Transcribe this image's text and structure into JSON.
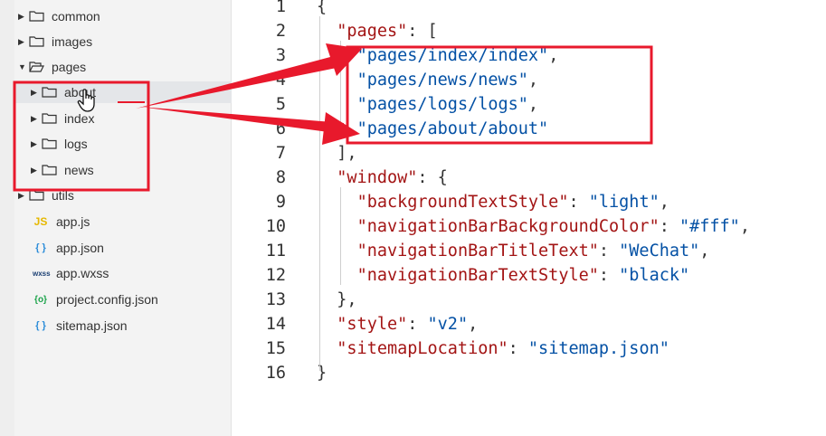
{
  "sidebar": {
    "items": [
      {
        "label": "common",
        "type": "folder",
        "expanded": false
      },
      {
        "label": "images",
        "type": "folder",
        "expanded": false
      },
      {
        "label": "pages",
        "type": "folder",
        "expanded": true
      },
      {
        "label": "about",
        "type": "folder",
        "expanded": false
      },
      {
        "label": "index",
        "type": "folder",
        "expanded": false
      },
      {
        "label": "logs",
        "type": "folder",
        "expanded": false
      },
      {
        "label": "news",
        "type": "folder",
        "expanded": false
      },
      {
        "label": "utils",
        "type": "folder",
        "expanded": false
      },
      {
        "label": "app.js",
        "type": "file",
        "icon": "js-file-icon",
        "badge": "JS"
      },
      {
        "label": "app.json",
        "type": "file",
        "icon": "json-file-icon",
        "badge": "{ }"
      },
      {
        "label": "app.wxss",
        "type": "file",
        "icon": "wxss-file-icon",
        "badge": "wxss"
      },
      {
        "label": "project.config.json",
        "type": "file",
        "icon": "config-file-icon",
        "badge": "{o}"
      },
      {
        "label": "sitemap.json",
        "type": "file",
        "icon": "json-file-icon",
        "badge": "{ }"
      }
    ]
  },
  "editor": {
    "lines": [
      {
        "n": "1",
        "tokens": [
          {
            "t": "{",
            "c": "punct"
          }
        ]
      },
      {
        "n": "2",
        "tokens": [
          {
            "t": "  ",
            "c": "punct"
          },
          {
            "t": "\"pages\"",
            "c": "key"
          },
          {
            "t": ": [",
            "c": "punct"
          }
        ]
      },
      {
        "n": "3",
        "tokens": [
          {
            "t": "    ",
            "c": "punct"
          },
          {
            "t": "\"pages/index/index\"",
            "c": "str"
          },
          {
            "t": ",",
            "c": "punct"
          }
        ]
      },
      {
        "n": "4",
        "tokens": [
          {
            "t": "    ",
            "c": "punct"
          },
          {
            "t": "\"pages/news/news\"",
            "c": "str"
          },
          {
            "t": ",",
            "c": "punct"
          }
        ]
      },
      {
        "n": "5",
        "tokens": [
          {
            "t": "    ",
            "c": "punct"
          },
          {
            "t": "\"pages/logs/logs\"",
            "c": "str"
          },
          {
            "t": ",",
            "c": "punct"
          }
        ]
      },
      {
        "n": "6",
        "tokens": [
          {
            "t": "    ",
            "c": "punct"
          },
          {
            "t": "\"pages/about/about\"",
            "c": "str"
          }
        ]
      },
      {
        "n": "7",
        "tokens": [
          {
            "t": "  ],",
            "c": "punct"
          }
        ]
      },
      {
        "n": "8",
        "tokens": [
          {
            "t": "  ",
            "c": "punct"
          },
          {
            "t": "\"window\"",
            "c": "key"
          },
          {
            "t": ": {",
            "c": "punct"
          }
        ]
      },
      {
        "n": "9",
        "tokens": [
          {
            "t": "    ",
            "c": "punct"
          },
          {
            "t": "\"backgroundTextStyle\"",
            "c": "key"
          },
          {
            "t": ": ",
            "c": "punct"
          },
          {
            "t": "\"light\"",
            "c": "str"
          },
          {
            "t": ",",
            "c": "punct"
          }
        ]
      },
      {
        "n": "10",
        "tokens": [
          {
            "t": "    ",
            "c": "punct"
          },
          {
            "t": "\"navigationBarBackgroundColor\"",
            "c": "key"
          },
          {
            "t": ": ",
            "c": "punct"
          },
          {
            "t": "\"#fff\"",
            "c": "str"
          },
          {
            "t": ",",
            "c": "punct"
          }
        ]
      },
      {
        "n": "11",
        "tokens": [
          {
            "t": "    ",
            "c": "punct"
          },
          {
            "t": "\"navigationBarTitleText\"",
            "c": "key"
          },
          {
            "t": ": ",
            "c": "punct"
          },
          {
            "t": "\"WeChat\"",
            "c": "str"
          },
          {
            "t": ",",
            "c": "punct"
          }
        ]
      },
      {
        "n": "12",
        "tokens": [
          {
            "t": "    ",
            "c": "punct"
          },
          {
            "t": "\"navigationBarTextStyle\"",
            "c": "key"
          },
          {
            "t": ": ",
            "c": "punct"
          },
          {
            "t": "\"black\"",
            "c": "str"
          }
        ]
      },
      {
        "n": "13",
        "tokens": [
          {
            "t": "  },",
            "c": "punct"
          }
        ]
      },
      {
        "n": "14",
        "tokens": [
          {
            "t": "  ",
            "c": "punct"
          },
          {
            "t": "\"style\"",
            "c": "key"
          },
          {
            "t": ": ",
            "c": "punct"
          },
          {
            "t": "\"v2\"",
            "c": "str"
          },
          {
            "t": ",",
            "c": "punct"
          }
        ]
      },
      {
        "n": "15",
        "tokens": [
          {
            "t": "  ",
            "c": "punct"
          },
          {
            "t": "\"sitemapLocation\"",
            "c": "key"
          },
          {
            "t": ": ",
            "c": "punct"
          },
          {
            "t": "\"sitemap.json\"",
            "c": "str"
          }
        ]
      },
      {
        "n": "16",
        "tokens": [
          {
            "t": "}",
            "c": "punct"
          }
        ]
      }
    ]
  },
  "colors": {
    "annotation_red": "#e8192c",
    "json_key": "#a31515",
    "json_string": "#0451a5",
    "sidebar_bg": "#f3f3f3"
  }
}
